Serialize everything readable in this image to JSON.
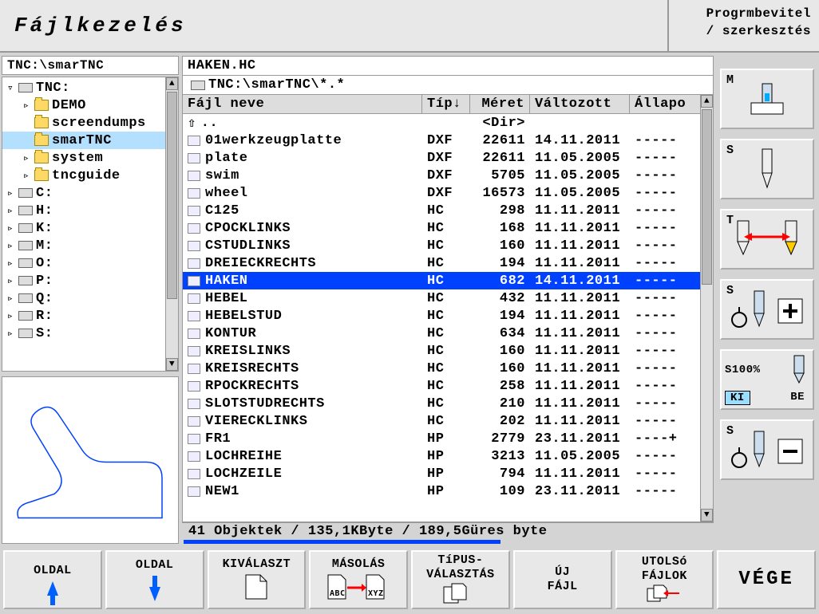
{
  "header": {
    "title": "Fájlkezelés",
    "mode_line1": "Progrmbevitel",
    "mode_line2": "/ szerkesztés"
  },
  "tree": {
    "path": "TNC:\\smarTNC",
    "nodes": [
      {
        "toggle": "▿",
        "indent": 0,
        "icon": "drive",
        "label": "TNC:",
        "sel": false
      },
      {
        "toggle": "▹",
        "indent": 1,
        "icon": "folder",
        "label": "DEMO",
        "sel": false
      },
      {
        "toggle": "",
        "indent": 1,
        "icon": "folder",
        "label": "screendumps",
        "sel": false
      },
      {
        "toggle": "",
        "indent": 1,
        "icon": "folder",
        "label": "smarTNC",
        "sel": true
      },
      {
        "toggle": "▹",
        "indent": 1,
        "icon": "folder",
        "label": "system",
        "sel": false
      },
      {
        "toggle": "▹",
        "indent": 1,
        "icon": "folder",
        "label": "tncguide",
        "sel": false
      },
      {
        "toggle": "▹",
        "indent": 0,
        "icon": "drive",
        "label": "C:",
        "sel": false
      },
      {
        "toggle": "▹",
        "indent": 0,
        "icon": "drive",
        "label": "H:",
        "sel": false
      },
      {
        "toggle": "▹",
        "indent": 0,
        "icon": "drive",
        "label": "K:",
        "sel": false
      },
      {
        "toggle": "▹",
        "indent": 0,
        "icon": "drive",
        "label": "M:",
        "sel": false
      },
      {
        "toggle": "▹",
        "indent": 0,
        "icon": "drive",
        "label": "O:",
        "sel": false
      },
      {
        "toggle": "▹",
        "indent": 0,
        "icon": "drive",
        "label": "P:",
        "sel": false
      },
      {
        "toggle": "▹",
        "indent": 0,
        "icon": "drive",
        "label": "Q:",
        "sel": false
      },
      {
        "toggle": "▹",
        "indent": 0,
        "icon": "drive",
        "label": "R:",
        "sel": false
      },
      {
        "toggle": "▹",
        "indent": 0,
        "icon": "drive",
        "label": "S:",
        "sel": false
      }
    ]
  },
  "filelist": {
    "title": "HAKEN.HC",
    "path": "TNC:\\smarTNC\\*.*",
    "cols": {
      "name": "Fájl neve",
      "type": "Típ↓",
      "size": "Méret",
      "date": "Változott",
      "stat": "Állapo"
    },
    "updir": {
      "name": "..",
      "type": "",
      "size": "<Dir>",
      "date": "",
      "stat": ""
    },
    "rows": [
      {
        "name": "01werkzeugplatte",
        "type": "DXF",
        "size": "22611",
        "date": "14.11.2011",
        "stat": "-----"
      },
      {
        "name": "plate",
        "type": "DXF",
        "size": "22611",
        "date": "11.05.2005",
        "stat": "-----"
      },
      {
        "name": "swim",
        "type": "DXF",
        "size": "5705",
        "date": "11.05.2005",
        "stat": "-----"
      },
      {
        "name": "wheel",
        "type": "DXF",
        "size": "16573",
        "date": "11.05.2005",
        "stat": "-----"
      },
      {
        "name": "C125",
        "type": "HC",
        "size": "298",
        "date": "11.11.2011",
        "stat": "-----"
      },
      {
        "name": "CPOCKLINKS",
        "type": "HC",
        "size": "168",
        "date": "11.11.2011",
        "stat": "-----"
      },
      {
        "name": "CSTUDLINKS",
        "type": "HC",
        "size": "160",
        "date": "11.11.2011",
        "stat": "-----"
      },
      {
        "name": "DREIECKRECHTS",
        "type": "HC",
        "size": "194",
        "date": "11.11.2011",
        "stat": "-----"
      },
      {
        "name": "HAKEN",
        "type": "HC",
        "size": "682",
        "date": "14.11.2011",
        "stat": "-----",
        "sel": true
      },
      {
        "name": "HEBEL",
        "type": "HC",
        "size": "432",
        "date": "11.11.2011",
        "stat": "-----"
      },
      {
        "name": "HEBELSTUD",
        "type": "HC",
        "size": "194",
        "date": "11.11.2011",
        "stat": "-----"
      },
      {
        "name": "KONTUR",
        "type": "HC",
        "size": "634",
        "date": "11.11.2011",
        "stat": "-----"
      },
      {
        "name": "KREISLINKS",
        "type": "HC",
        "size": "160",
        "date": "11.11.2011",
        "stat": "-----"
      },
      {
        "name": "KREISRECHTS",
        "type": "HC",
        "size": "160",
        "date": "11.11.2011",
        "stat": "-----"
      },
      {
        "name": "RPOCKRECHTS",
        "type": "HC",
        "size": "258",
        "date": "11.11.2011",
        "stat": "-----"
      },
      {
        "name": "SLOTSTUDRECHTS",
        "type": "HC",
        "size": "210",
        "date": "11.11.2011",
        "stat": "-----"
      },
      {
        "name": "VIERECKLINKS",
        "type": "HC",
        "size": "202",
        "date": "11.11.2011",
        "stat": "-----"
      },
      {
        "name": "FR1",
        "type": "HP",
        "size": "2779",
        "date": "23.11.2011",
        "stat": "----+"
      },
      {
        "name": "LOCHREIHE",
        "type": "HP",
        "size": "3213",
        "date": "11.05.2005",
        "stat": "-----"
      },
      {
        "name": "LOCHZEILE",
        "type": "HP",
        "size": "794",
        "date": "11.11.2011",
        "stat": "-----"
      },
      {
        "name": "NEW1",
        "type": "HP",
        "size": "109",
        "date": "23.11.2011",
        "stat": "-----"
      }
    ],
    "status": "41 Objektek / 135,1KByte / 189,5Güres byte"
  },
  "softkeys_h": [
    {
      "line1": "OLDAL",
      "icon": "arrow-up"
    },
    {
      "line1": "OLDAL",
      "icon": "arrow-down"
    },
    {
      "line1": "KIVÁLASZT",
      "icon": "doc"
    },
    {
      "line1": "MÁSOLÁS",
      "icon": "copy"
    },
    {
      "line1": "TíPUS-",
      "line2": "VÁLASZTÁS",
      "icon": "type"
    },
    {
      "line1": "ÚJ",
      "line2": "FÁJL",
      "icon": ""
    },
    {
      "line1": "UTOLSó",
      "line2": "FÁJLOK",
      "icon": "recent"
    },
    {
      "line1": "VÉGE",
      "end": true
    }
  ],
  "softkeys_v": [
    {
      "lbl": "M",
      "kind": "machine"
    },
    {
      "lbl": "S",
      "kind": "spindle"
    },
    {
      "lbl": "T",
      "kind": "tool"
    },
    {
      "lbl": "S",
      "kind": "plus"
    },
    {
      "lbl": "S100%",
      "kind": "kibe",
      "ki": "KI",
      "be": "BE"
    },
    {
      "lbl": "S",
      "kind": "minus"
    }
  ]
}
